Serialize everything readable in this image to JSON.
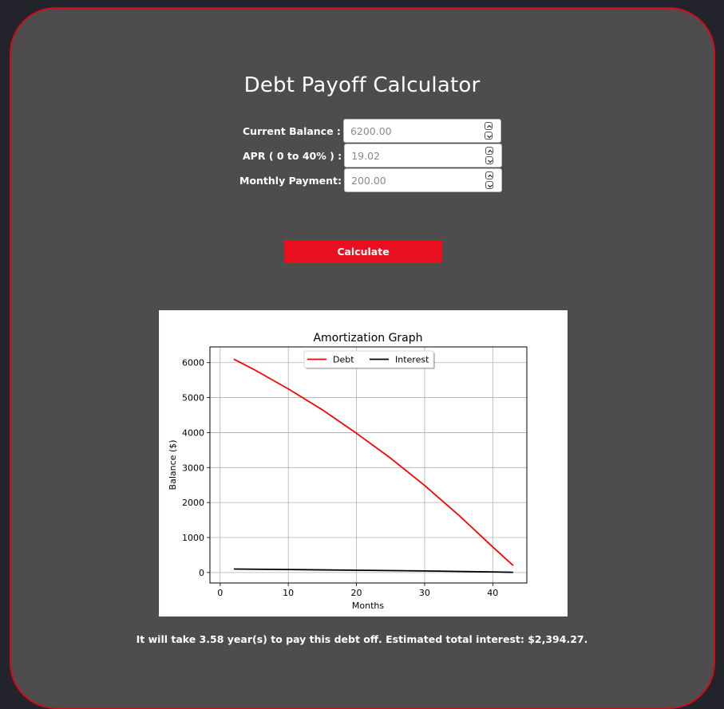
{
  "title": "Debt Payoff Calculator",
  "form": {
    "balance": {
      "label": "Current Balance :",
      "placeholder": "6200.00"
    },
    "apr": {
      "label": "APR ( 0 to 40% ) :",
      "placeholder": "19.02"
    },
    "payment": {
      "label": "Monthly Payment:",
      "placeholder": "200.00"
    }
  },
  "calculate_label": "Calculate",
  "result_text": "It will take 3.58 year(s) to pay this debt off. Estimated total interest: $2,394.27.",
  "colors": {
    "accent": "#e8101f",
    "card_bg": "#4f4c4d",
    "page_bg": "#23232b"
  },
  "icons": [
    "chevron-up-icon",
    "chevron-down-icon"
  ],
  "chart_data": {
    "type": "line",
    "title": "Amortization Graph",
    "xlabel": "Months",
    "ylabel": "Balance ($)",
    "xlim": [
      -1.5,
      45
    ],
    "ylim": [
      -300,
      6450
    ],
    "xticks": [
      0,
      10,
      20,
      30,
      40
    ],
    "yticks": [
      0,
      1000,
      2000,
      3000,
      4000,
      5000,
      6000
    ],
    "grid": true,
    "legend": "top-center",
    "series": [
      {
        "name": "Debt",
        "color": "#ff0000",
        "x": [
          2,
          5,
          10,
          15,
          20,
          25,
          30,
          35,
          40,
          43
        ],
        "y": [
          6100,
          5800,
          5250,
          4650,
          3980,
          3270,
          2490,
          1640,
          730,
          200
        ]
      },
      {
        "name": "Interest",
        "color": "#000000",
        "x": [
          2,
          10,
          20,
          30,
          40,
          43
        ],
        "y": [
          100,
          85,
          65,
          45,
          18,
          5
        ]
      }
    ]
  }
}
